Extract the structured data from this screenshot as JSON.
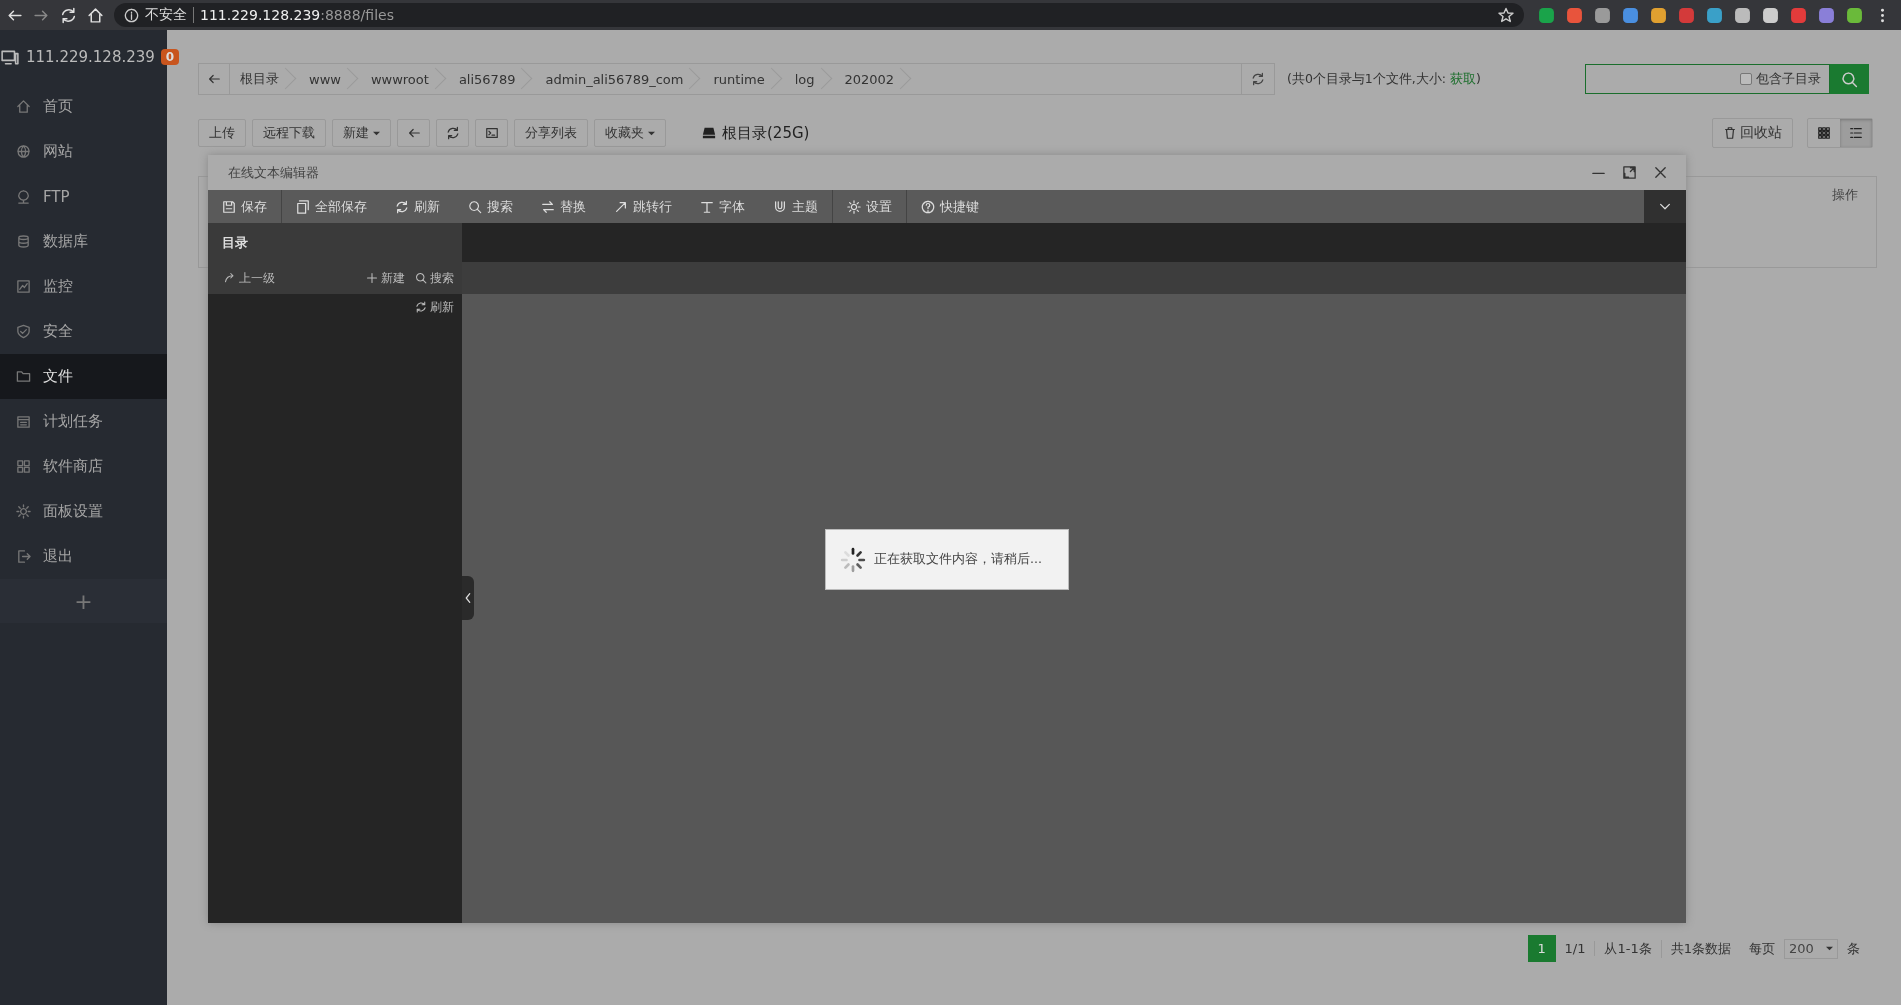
{
  "browser": {
    "security": "不安全",
    "host": "111.229.128.239",
    "path": ":8888/files"
  },
  "sidebar": {
    "host": "111.229.128.239",
    "badge": "0",
    "add": "+",
    "items": [
      {
        "label": "首页",
        "selected": false
      },
      {
        "label": "网站",
        "selected": false
      },
      {
        "label": "FTP",
        "selected": false
      },
      {
        "label": "数据库",
        "selected": false
      },
      {
        "label": "监控",
        "selected": false
      },
      {
        "label": "安全",
        "selected": false
      },
      {
        "label": "文件",
        "selected": true
      },
      {
        "label": "计划任务",
        "selected": false
      },
      {
        "label": "软件商店",
        "selected": false
      },
      {
        "label": "面板设置",
        "selected": false
      },
      {
        "label": "退出",
        "selected": false
      }
    ]
  },
  "breadcrumb": [
    "根目录",
    "www",
    "wwwroot",
    "ali56789",
    "admin_ali56789_com",
    "runtime",
    "log",
    "202002"
  ],
  "dir_info": {
    "text": "(共0个目录与1个文件,大小: ",
    "link": "获取",
    "end": ")"
  },
  "search": {
    "checkbox_label": "包含子目录",
    "checked": false
  },
  "toolbar": [
    {
      "kind": "text",
      "label": "上传"
    },
    {
      "kind": "text",
      "label": "远程下载"
    },
    {
      "kind": "dropdown",
      "label": "新建"
    },
    {
      "kind": "icon"
    },
    {
      "kind": "icon"
    },
    {
      "kind": "icon"
    },
    {
      "kind": "text",
      "label": "分享列表"
    },
    {
      "kind": "dropdown",
      "label": "收藏夹"
    }
  ],
  "disk": "根目录(25G)",
  "recycle": "回收站",
  "views": [
    {
      "selected": false
    },
    {
      "selected": true
    }
  ],
  "table": {
    "action_header": "操作"
  },
  "editor": {
    "title": "在线文本编辑器",
    "tools": [
      {
        "label": "保存",
        "separator": true
      },
      {
        "label": "全部保存",
        "separator": false
      },
      {
        "label": "刷新",
        "separator": false
      },
      {
        "label": "搜索",
        "separator": false
      },
      {
        "label": "替换",
        "separator": false
      },
      {
        "label": "跳转行",
        "separator": false
      },
      {
        "label": "字体",
        "separator": false
      },
      {
        "label": "主题",
        "separator": true
      },
      {
        "label": "设置",
        "separator": true
      },
      {
        "label": "快捷键",
        "separator": false
      }
    ],
    "dir_title": "目录",
    "up": "上一级",
    "new": "新建",
    "search": "搜索",
    "refresh": "刷新",
    "loading": "正在获取文件内容，请稍后..."
  },
  "pagination": {
    "current": "1",
    "pages": "1/1",
    "range": "从1-1条",
    "total": "共1条数据",
    "per_page_label": "每页",
    "per_page": "200",
    "unit": "条"
  }
}
